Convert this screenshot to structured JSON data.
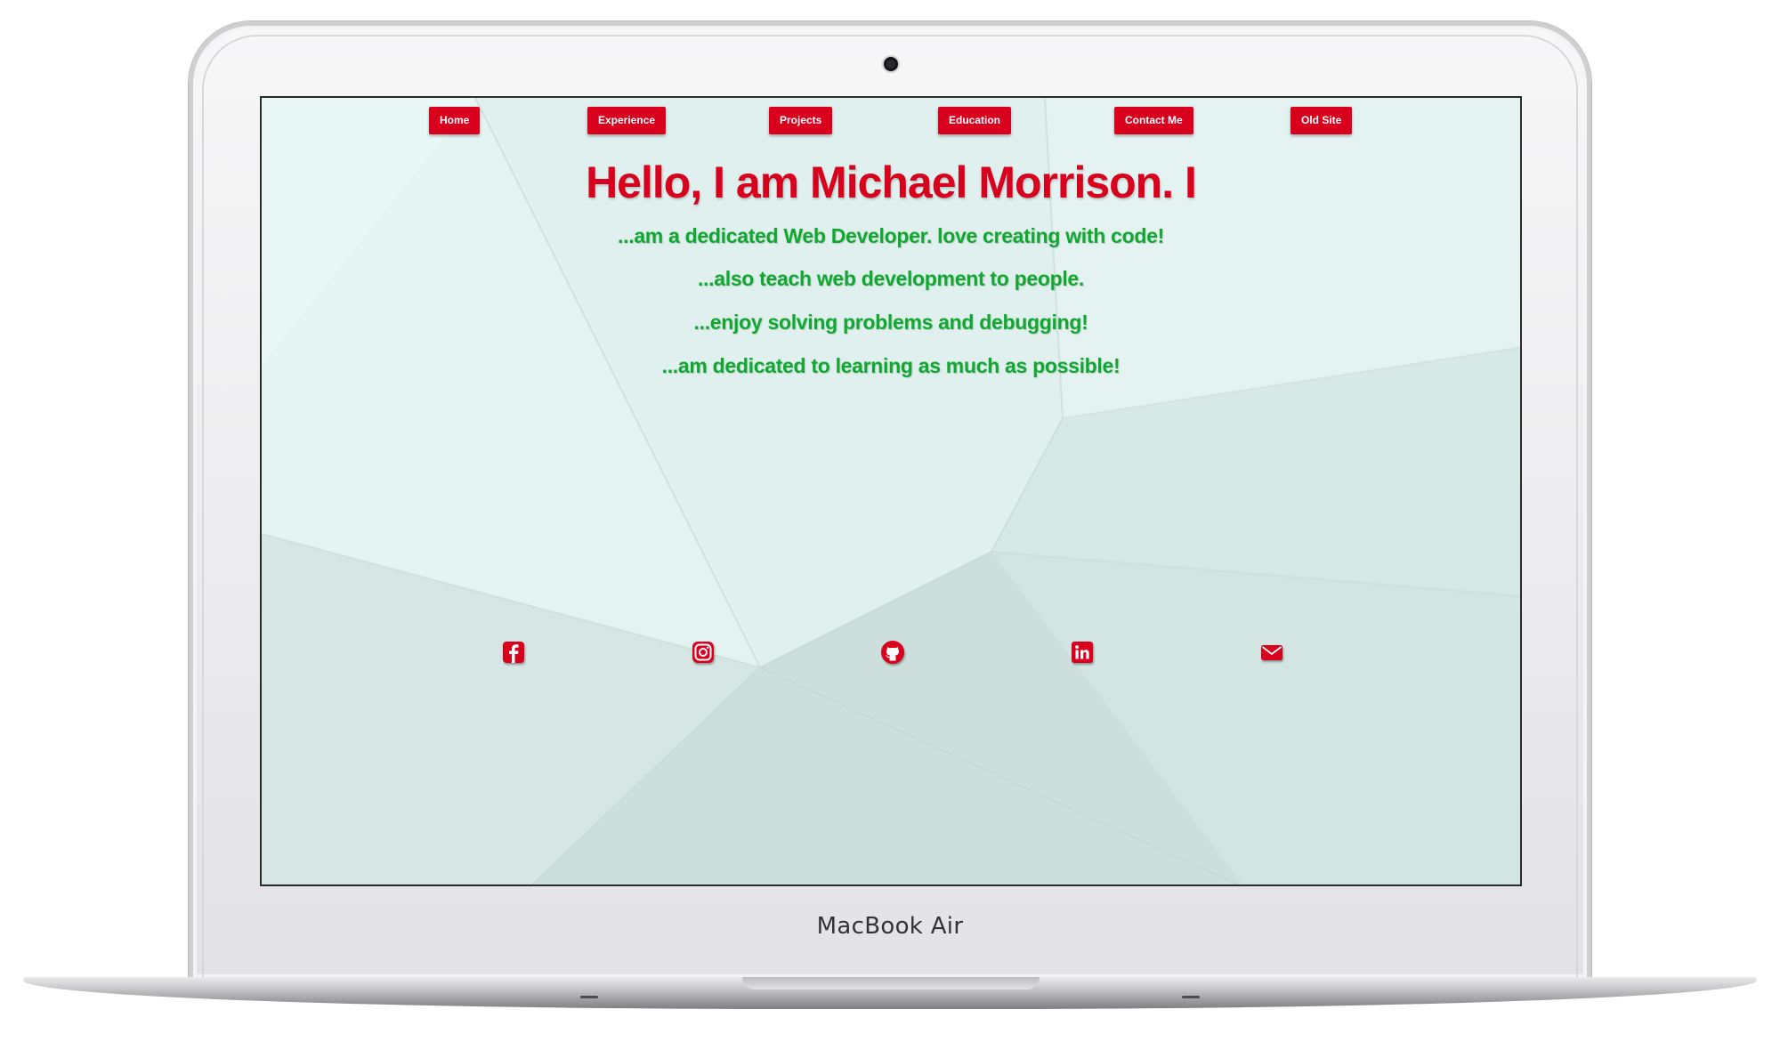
{
  "device": {
    "label": "MacBook Air"
  },
  "nav": {
    "items": [
      {
        "label": "Home"
      },
      {
        "label": "Experience"
      },
      {
        "label": "Projects"
      },
      {
        "label": "Education"
      },
      {
        "label": "Contact Me"
      },
      {
        "label": "Old Site"
      }
    ]
  },
  "hero": {
    "title": "Hello, I am Michael Morrison. I",
    "lines": [
      "...am a dedicated Web Developer. love creating with code!",
      "...also teach web development to people.",
      "...enjoy solving problems and debugging!",
      "...am dedicated to learning as much as possible!"
    ]
  },
  "social": {
    "icons": [
      "facebook-icon",
      "instagram-icon",
      "github-icon",
      "linkedin-icon",
      "email-icon"
    ]
  },
  "colors": {
    "accent": "#d9001e",
    "text_green": "#11a830",
    "background": "#dceeeb"
  }
}
